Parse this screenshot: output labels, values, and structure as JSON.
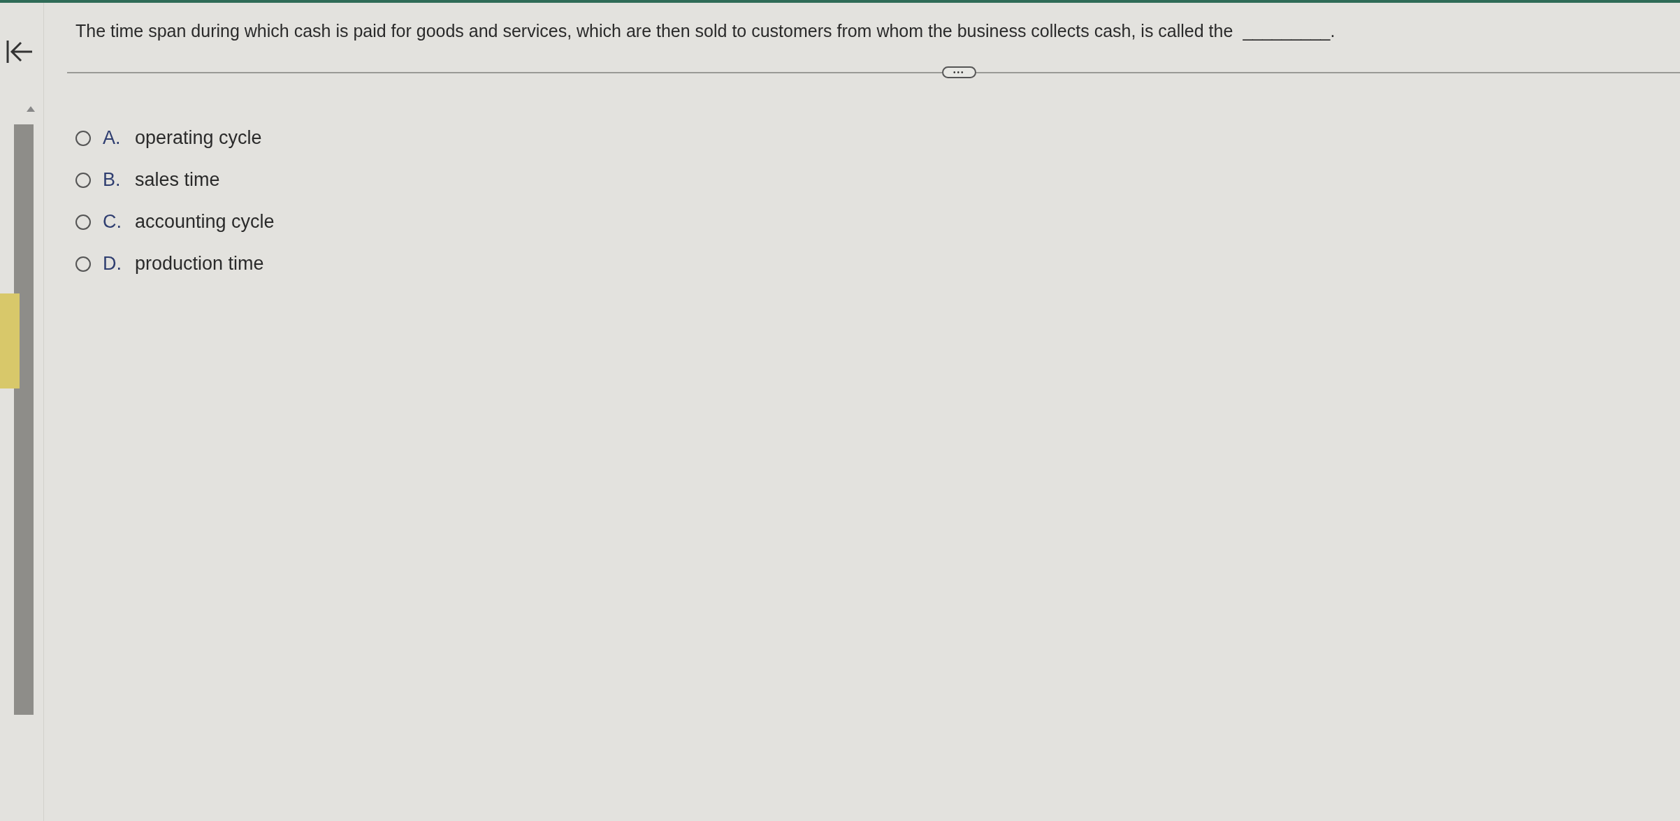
{
  "question": {
    "text": "The time span during which cash is paid for goods and services, which are then sold to customers from whom the business collects cash, is called the",
    "blank": "_________."
  },
  "options": [
    {
      "letter": "A.",
      "label": "operating cycle",
      "selected": false
    },
    {
      "letter": "B.",
      "label": "sales time",
      "selected": false
    },
    {
      "letter": "C.",
      "label": "accounting cycle",
      "selected": false
    },
    {
      "letter": "D.",
      "label": "production time",
      "selected": false
    }
  ],
  "more_button": {
    "label": "•••"
  }
}
